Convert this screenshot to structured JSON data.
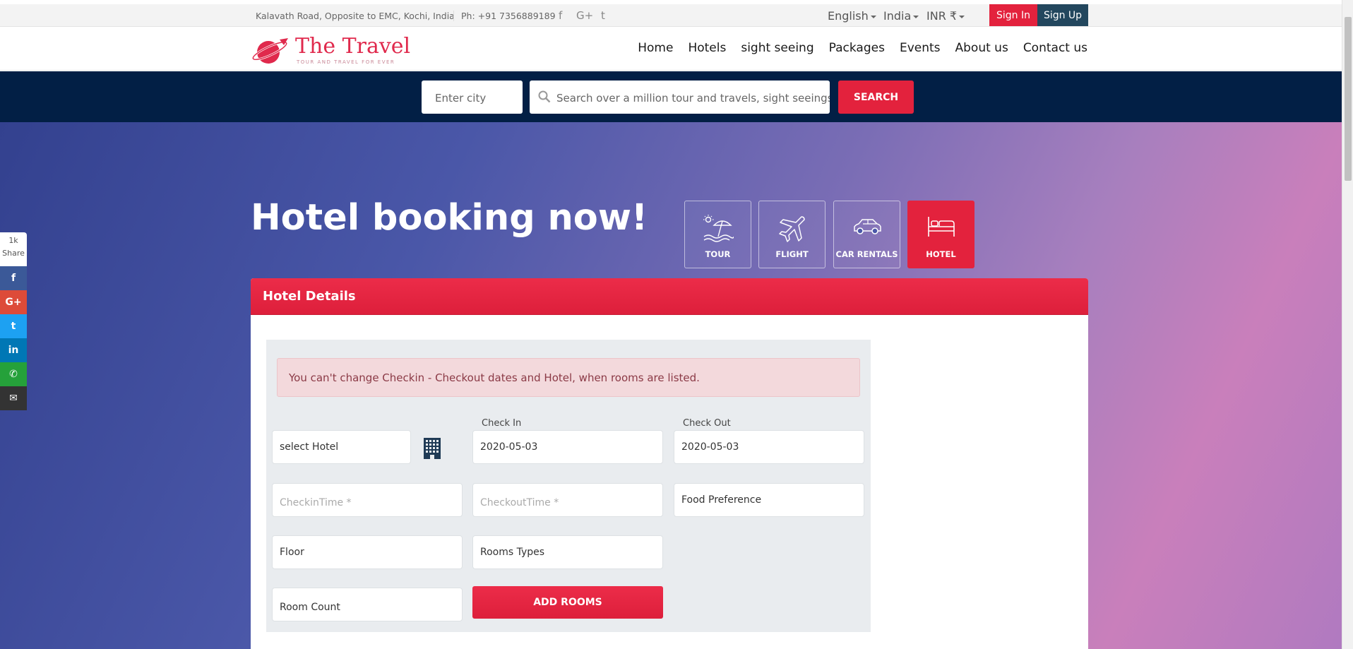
{
  "topbar": {
    "address": "Kalavath Road, Opposite to EMC, Kochi, India",
    "phone": "Ph: +91 7356889189",
    "social": [
      "f",
      "G+",
      "t"
    ],
    "language": "English",
    "country": "India",
    "currency": "INR ₹",
    "signin": "Sign In",
    "signup": "Sign Up"
  },
  "brand": {
    "title": "The Travel",
    "tagline": "TOUR AND TRAVEL FOR EVER"
  },
  "nav": [
    "Home",
    "Hotels",
    "sight seeing",
    "Packages",
    "Events",
    "About us",
    "Contact us"
  ],
  "search": {
    "city_placeholder": "Enter city",
    "query_placeholder": "Search over a million tour and travels, sight seeings,...",
    "button": "SEARCH"
  },
  "hero": {
    "title": "Hotel booking now!"
  },
  "categories": [
    {
      "label": "TOUR",
      "icon": "beach-umbrella-icon"
    },
    {
      "label": "FLIGHT",
      "icon": "airplane-icon"
    },
    {
      "label": "CAR RENTALS",
      "icon": "car-icon"
    },
    {
      "label": "HOTEL",
      "icon": "bed-icon",
      "active": true
    }
  ],
  "panel": {
    "title": "Hotel Details",
    "alert": "You can't change Checkin - Checkout dates and Hotel, when rooms are listed.",
    "hotel_select": "select Hotel",
    "checkin_label": "Check In",
    "checkin_value": "2020-05-03",
    "checkout_label": "Check Out",
    "checkout_value": "2020-05-03",
    "checkin_time_placeholder": "CheckinTime *",
    "checkout_time_placeholder": "CheckoutTime *",
    "food_preference": "Food Preference",
    "floor": "Floor",
    "room_types": "Rooms Types",
    "room_count": "Room Count",
    "add_rooms": "ADD ROOMS"
  },
  "share": {
    "count": "1k",
    "label": "Share",
    "buttons": [
      {
        "icon": "facebook-icon",
        "glyph": "f",
        "color": "#3b5998"
      },
      {
        "icon": "google-plus-icon",
        "glyph": "G+",
        "color": "#dd4b39"
      },
      {
        "icon": "twitter-icon",
        "glyph": "t",
        "color": "#1da1f2"
      },
      {
        "icon": "linkedin-icon",
        "glyph": "in",
        "color": "#0077b5"
      },
      {
        "icon": "whatsapp-icon",
        "glyph": "✆",
        "color": "#25a13a"
      },
      {
        "icon": "email-icon",
        "glyph": "✉",
        "color": "#333333"
      }
    ]
  },
  "colors": {
    "accent": "#e3223d",
    "navy": "#021f45",
    "signup": "#23475e"
  }
}
